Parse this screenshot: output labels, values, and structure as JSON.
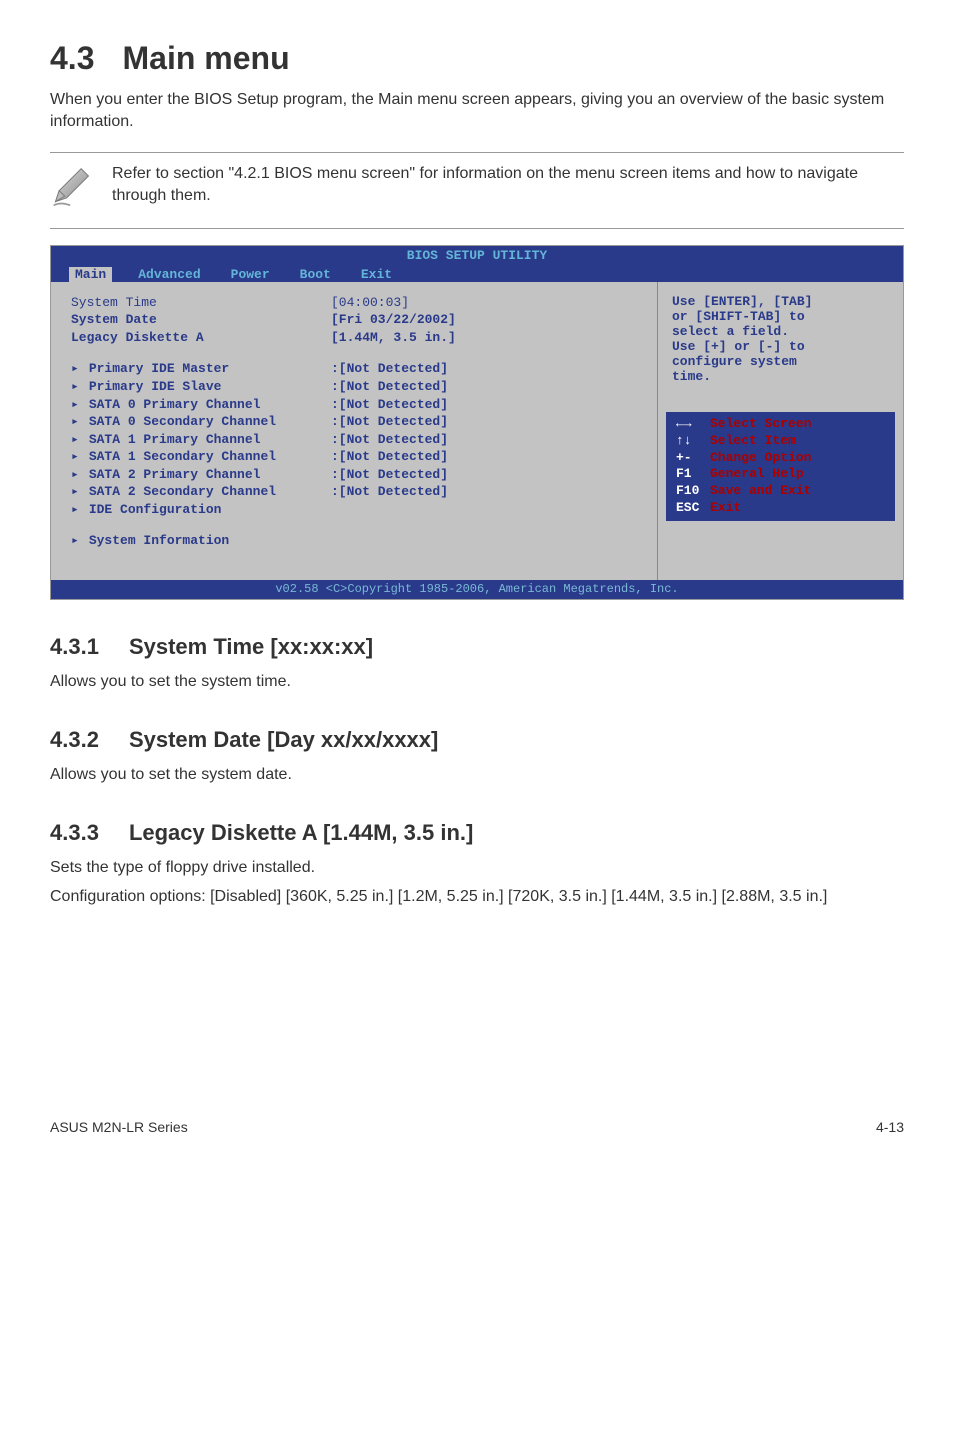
{
  "section": {
    "number": "4.3",
    "title": "Main menu",
    "intro": "When you enter the BIOS Setup program, the Main menu screen appears, giving you an overview of the basic system information."
  },
  "note": {
    "text": "Refer to section \"4.2.1 BIOS menu screen\" for information on the menu screen items and how to navigate through them."
  },
  "bios": {
    "title": "BIOS SETUP UTILITY",
    "tabs": [
      "Main",
      "Advanced",
      "Power",
      "Boot",
      "Exit"
    ],
    "active_tab": "Main",
    "rows_top": [
      {
        "label": "System Time",
        "value": "[04:00:03]",
        "bold": false
      },
      {
        "label": "System Date",
        "value": "[Fri 03/22/2002]",
        "bold": true
      },
      {
        "label": "Legacy Diskette A",
        "value": "[1.44M, 3.5 in.]",
        "bold": true
      }
    ],
    "rows_items": [
      {
        "label": "Primary IDE Master",
        "value": ":[Not Detected]"
      },
      {
        "label": "Primary IDE Slave",
        "value": ":[Not Detected]"
      },
      {
        "label": "SATA 0 Primary Channel",
        "value": ":[Not Detected]"
      },
      {
        "label": "SATA 0 Secondary Channel",
        "value": ":[Not Detected]"
      },
      {
        "label": "SATA 1 Primary Channel",
        "value": ":[Not Detected]"
      },
      {
        "label": "SATA 1 Secondary Channel",
        "value": ":[Not Detected]"
      },
      {
        "label": "SATA 2 Primary Channel",
        "value": ":[Not Detected]"
      },
      {
        "label": "SATA 2 Secondary Channel",
        "value": ":[Not Detected]"
      },
      {
        "label": "IDE Configuration",
        "value": ""
      }
    ],
    "rows_bottom": [
      {
        "label": "System Information",
        "value": ""
      }
    ],
    "help_top": [
      "Use [ENTER], [TAB]",
      "or [SHIFT-TAB] to",
      "select a field.",
      "",
      "Use [+] or [-] to",
      "configure system",
      "time."
    ],
    "help_bottom": [
      {
        "key": "←→",
        "text": "Select Screen"
      },
      {
        "key": "↑↓",
        "text": "Select Item"
      },
      {
        "key": "+-",
        "text": "Change Option"
      },
      {
        "key": "F1",
        "text": "General Help"
      },
      {
        "key": "F10",
        "text": "Save and Exit"
      },
      {
        "key": "ESC",
        "text": "Exit"
      }
    ],
    "footer": "v02.58 <C>Copyright 1985-2006, American Megatrends, Inc."
  },
  "subs": [
    {
      "num": "4.3.1",
      "title": "System Time [xx:xx:xx]",
      "lines": [
        "Allows you to set the system time."
      ]
    },
    {
      "num": "4.3.2",
      "title": "System Date [Day xx/xx/xxxx]",
      "lines": [
        "Allows you to set the system date."
      ]
    },
    {
      "num": "4.3.3",
      "title": "Legacy Diskette A [1.44M, 3.5 in.]",
      "lines": [
        "Sets the type of floppy drive installed.",
        "Configuration options: [Disabled] [360K, 5.25 in.]  [1.2M, 5.25 in.] [720K, 3.5 in.] [1.44M, 3.5 in.] [2.88M, 3.5 in.]"
      ]
    }
  ],
  "footer": {
    "left": "ASUS M2N-LR Series",
    "right": "4-13"
  }
}
